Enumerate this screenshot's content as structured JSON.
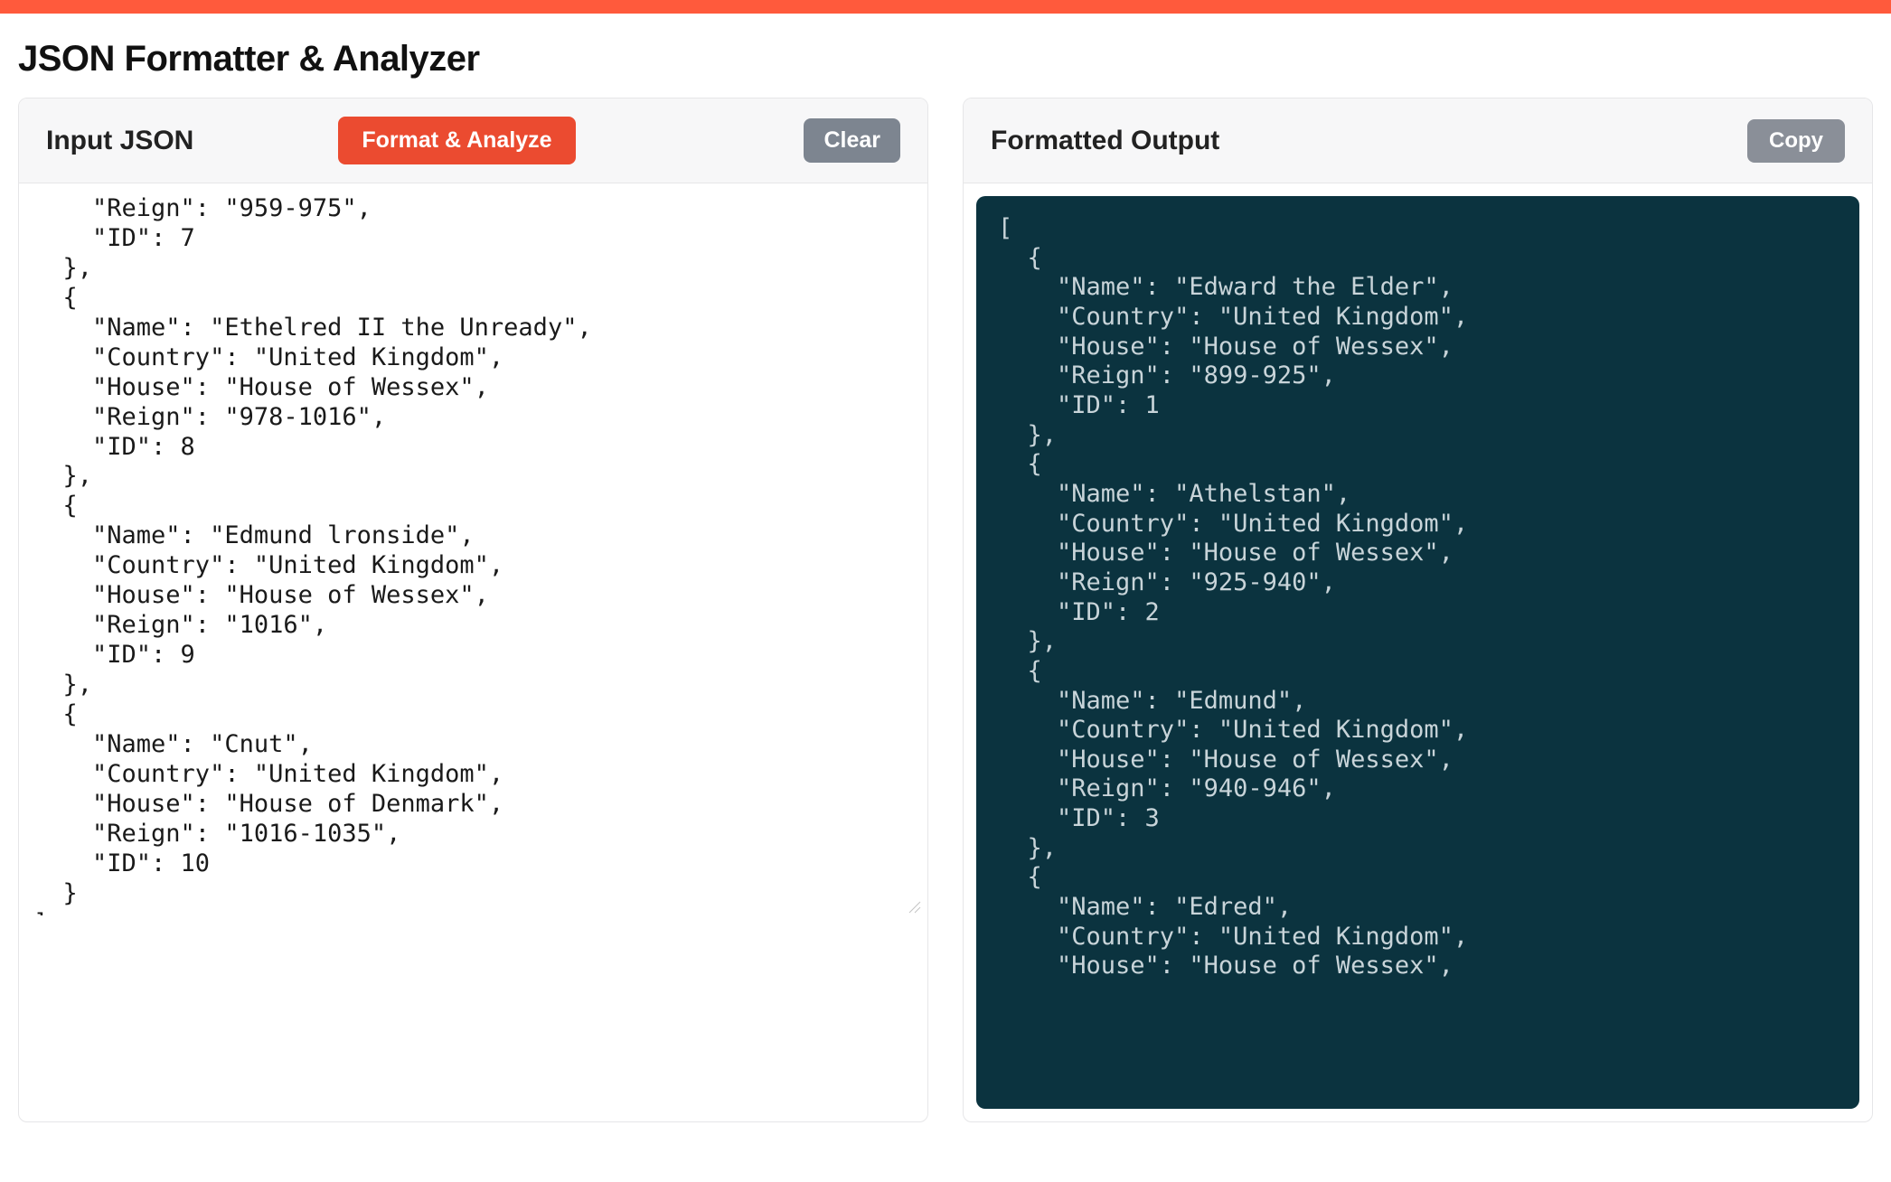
{
  "page": {
    "title": "JSON Formatter & Analyzer"
  },
  "input_panel": {
    "title": "Input JSON",
    "format_button": "Format & Analyze",
    "clear_button": "Clear",
    "textarea_value": "    \"Reign\": \"959-975\",\n    \"ID\": 7\n  },\n  {\n    \"Name\": \"Ethelred II the Unready\",\n    \"Country\": \"United Kingdom\",\n    \"House\": \"House of Wessex\",\n    \"Reign\": \"978-1016\",\n    \"ID\": 8\n  },\n  {\n    \"Name\": \"Edmund lronside\",\n    \"Country\": \"United Kingdom\",\n    \"House\": \"House of Wessex\",\n    \"Reign\": \"1016\",\n    \"ID\": 9\n  },\n  {\n    \"Name\": \"Cnut\",\n    \"Country\": \"United Kingdom\",\n    \"House\": \"House of Denmark\",\n    \"Reign\": \"1016-1035\",\n    \"ID\": 10\n  }\n]"
  },
  "output_panel": {
    "title": "Formatted Output",
    "copy_button": "Copy",
    "content": "[\n  {\n    \"Name\": \"Edward the Elder\",\n    \"Country\": \"United Kingdom\",\n    \"House\": \"House of Wessex\",\n    \"Reign\": \"899-925\",\n    \"ID\": 1\n  },\n  {\n    \"Name\": \"Athelstan\",\n    \"Country\": \"United Kingdom\",\n    \"House\": \"House of Wessex\",\n    \"Reign\": \"925-940\",\n    \"ID\": 2\n  },\n  {\n    \"Name\": \"Edmund\",\n    \"Country\": \"United Kingdom\",\n    \"House\": \"House of Wessex\",\n    \"Reign\": \"940-946\",\n    \"ID\": 3\n  },\n  {\n    \"Name\": \"Edred\",\n    \"Country\": \"United Kingdom\",\n    \"House\": \"House of Wessex\","
  },
  "formatted_data": [
    {
      "Name": "Edward the Elder",
      "Country": "United Kingdom",
      "House": "House of Wessex",
      "Reign": "899-925",
      "ID": 1
    },
    {
      "Name": "Athelstan",
      "Country": "United Kingdom",
      "House": "House of Wessex",
      "Reign": "925-940",
      "ID": 2
    },
    {
      "Name": "Edmund",
      "Country": "United Kingdom",
      "House": "House of Wessex",
      "Reign": "940-946",
      "ID": 3
    },
    {
      "Name": "Edred",
      "Country": "United Kingdom",
      "House": "House of Wessex"
    }
  ],
  "input_data_tail": [
    {
      "Reign": "959-975",
      "ID": 7
    },
    {
      "Name": "Ethelred II the Unready",
      "Country": "United Kingdom",
      "House": "House of Wessex",
      "Reign": "978-1016",
      "ID": 8
    },
    {
      "Name": "Edmund lronside",
      "Country": "United Kingdom",
      "House": "House of Wessex",
      "Reign": "1016",
      "ID": 9
    },
    {
      "Name": "Cnut",
      "Country": "United Kingdom",
      "House": "House of Denmark",
      "Reign": "1016-1035",
      "ID": 10
    }
  ]
}
